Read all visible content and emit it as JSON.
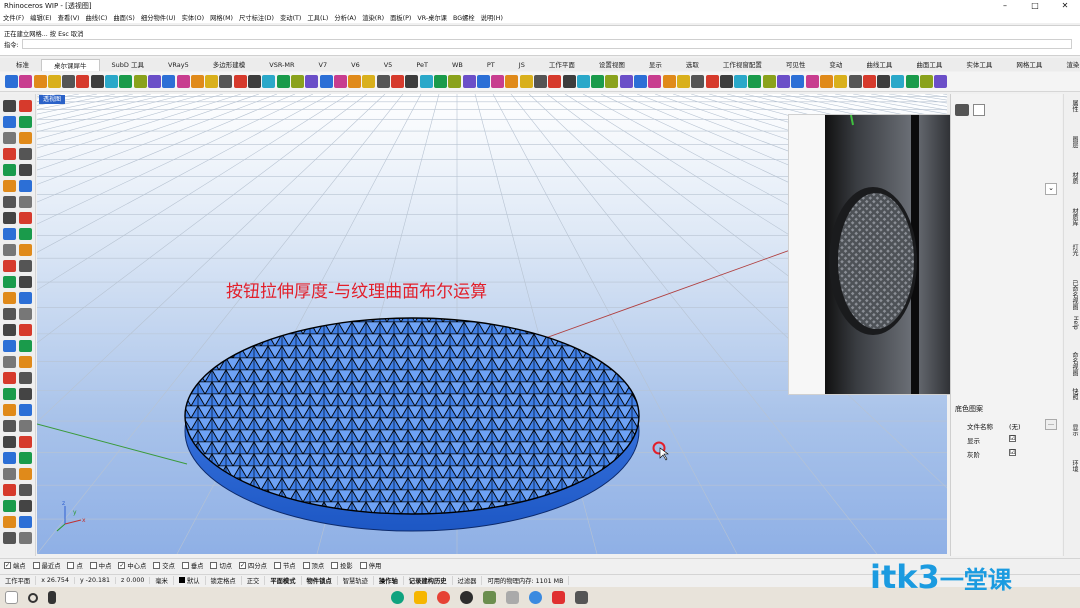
{
  "window": {
    "title": "Rhinoceros WIP - [透视图]",
    "controls": [
      "–",
      "□",
      "✕"
    ]
  },
  "menu": [
    "文件(F)",
    "编辑(E)",
    "查看(V)",
    "曲线(C)",
    "曲面(S)",
    "细分物件(U)",
    "实体(O)",
    "网格(M)",
    "尺寸标注(D)",
    "变动(T)",
    "工具(L)",
    "分析(A)",
    "渲染(R)",
    "面板(P)",
    "VR-桌尔课",
    "BG螺栓",
    "说明(H)"
  ],
  "command": {
    "history": "正在建立网格... 按 Esc 取消",
    "prompt": "指令:"
  },
  "tabs": [
    "标准",
    "桌尔课犀牛",
    "SubD 工具",
    "VRay5",
    "多边形建模",
    "VSR-MR",
    "V7",
    "V6",
    "V5",
    "PeT",
    "WB",
    "PT",
    "JS",
    "工作平面",
    "设置视图",
    "显示",
    "选取",
    "工作视窗配置",
    "可见性",
    "变动",
    "曲线工具",
    "曲面工具",
    "实体工具",
    "网格工具",
    "渲染"
  ],
  "active_tab": "桌尔课犀牛",
  "viewport": {
    "label": "透视图",
    "overlay_text": "按钮拉伸厚度-与纹理曲面布尔运算"
  },
  "right_panel": {
    "section": "底色图案",
    "rows": [
      {
        "label": "文件名称",
        "value": "(无)"
      },
      {
        "label": "显示",
        "value": "☑"
      },
      {
        "label": "灰阶",
        "value": "☑"
      }
    ],
    "button": "…"
  },
  "right_strip": [
    "属性",
    "图层",
    "材质",
    "材质库",
    "灯光",
    "已命名视图",
    "Help",
    "命名视图",
    "快照",
    "显示",
    "环境"
  ],
  "osnaps": [
    {
      "label": "端点",
      "checked": true
    },
    {
      "label": "最近点",
      "checked": false
    },
    {
      "label": "点",
      "checked": false
    },
    {
      "label": "中点",
      "checked": false
    },
    {
      "label": "中心点",
      "checked": true
    },
    {
      "label": "交点",
      "checked": false
    },
    {
      "label": "垂点",
      "checked": false
    },
    {
      "label": "切点",
      "checked": false
    },
    {
      "label": "四分点",
      "checked": true
    },
    {
      "label": "节点",
      "checked": false
    },
    {
      "label": "顶点",
      "checked": false
    },
    {
      "label": "投影",
      "checked": false
    },
    {
      "label": "停用",
      "checked": false
    }
  ],
  "status": {
    "cplane": "工作平面",
    "x": "x 26.754",
    "y": "y -20.181",
    "z": "z 0.000",
    "units": "毫米",
    "layer": "默认",
    "toggles": [
      "锁定格点",
      "正交",
      "平面模式",
      "物件锁点",
      "智慧轨迹",
      "操作轴",
      "记录建构历史",
      "过滤器"
    ],
    "memory": "可用的物理内存: 1101 MB"
  },
  "watermark": {
    "main": "itk3",
    "cn": "一堂课"
  },
  "colors": {
    "accent": "#2b62c8",
    "overlay": "#e21f2a",
    "watermark": "#1b9be0"
  }
}
